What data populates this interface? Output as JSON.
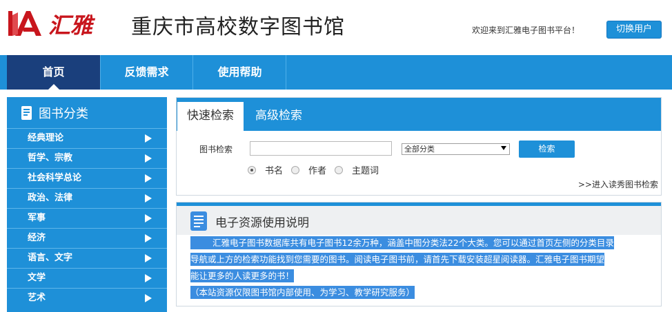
{
  "header": {
    "logo_text": "汇雅",
    "site_title": "重庆市高校数字图书馆",
    "welcome": "欢迎来到汇雅电子图书平台！",
    "switch_user": "切换用户"
  },
  "nav": {
    "items": [
      {
        "label": "首页"
      },
      {
        "label": "反馈需求"
      },
      {
        "label": "使用帮助"
      }
    ]
  },
  "sidebar": {
    "title": "图书分类",
    "items": [
      {
        "label": "经典理论"
      },
      {
        "label": "哲学、宗教"
      },
      {
        "label": "社会科学总论"
      },
      {
        "label": "政治、法律"
      },
      {
        "label": "军事"
      },
      {
        "label": "经济"
      },
      {
        "label": "语言、文字"
      },
      {
        "label": "文学"
      },
      {
        "label": "艺术"
      }
    ]
  },
  "search": {
    "tabs": [
      {
        "label": "快速检索"
      },
      {
        "label": "高级检索"
      }
    ],
    "label": "图书检索",
    "input_value": "",
    "category_selected": "全部分类",
    "button": "检索",
    "radios": [
      {
        "label": "书名",
        "checked": true
      },
      {
        "label": "作者",
        "checked": false
      },
      {
        "label": "主题词",
        "checked": false
      }
    ],
    "advanced_link": ">>进入读秀图书检索"
  },
  "resources": {
    "title": "电子资源使用说明",
    "para_line1": "汇雅电子图书数据库共有电子图书12余万种，涵盖中图分类法22个大类。您可以通过首页左侧的分类目录",
    "para_line2": "导航或上方的检索功能找到您需要的图书。阅读电子图书前，请首先下载安装超星阅读器。汇雅电子图书期望",
    "para_line3": "能让更多的人读更多的书！",
    "note": "（本站资源仅限图书馆内部使用、为学习、教学研究服务）"
  },
  "colors": {
    "primary": "#1e90d8",
    "nav_active": "#1a3f7c",
    "logo_red": "#c8161d",
    "highlight": "#3b8de0"
  }
}
